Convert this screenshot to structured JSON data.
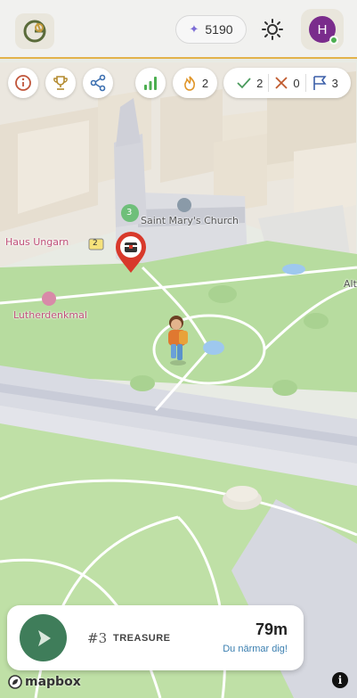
{
  "header": {
    "logo_icon": "compass-logo",
    "points_value": "5190",
    "theme_icon": "sun-icon",
    "avatar_initial": "H",
    "colors": {
      "accent_border": "#e2b24a",
      "avatar": "#7a2c8c",
      "status_online": "#4caf50"
    }
  },
  "toolbar": {
    "info_icon": "info-icon",
    "trophy_icon": "trophy-icon",
    "share_icon": "share-icon",
    "signal_icon": "signal-bars-icon",
    "streak_value": "2",
    "correct_value": "2",
    "wrong_value": "0",
    "flags_value": "3"
  },
  "map": {
    "labels": {
      "church": "Saint Mary's Church",
      "haus": "Haus Ungarn",
      "luther": "Lutherdenkmal",
      "alt": "Alt",
      "road_badge": "2",
      "cluster_count": "3"
    }
  },
  "quest_card": {
    "number": "#3",
    "type": "TREASURE",
    "distance": "79m",
    "hint": "Du närmar dig!",
    "play_color": "#3f7d5a"
  },
  "footer": {
    "mapbox_label": "mapbox",
    "info_label": "i"
  }
}
